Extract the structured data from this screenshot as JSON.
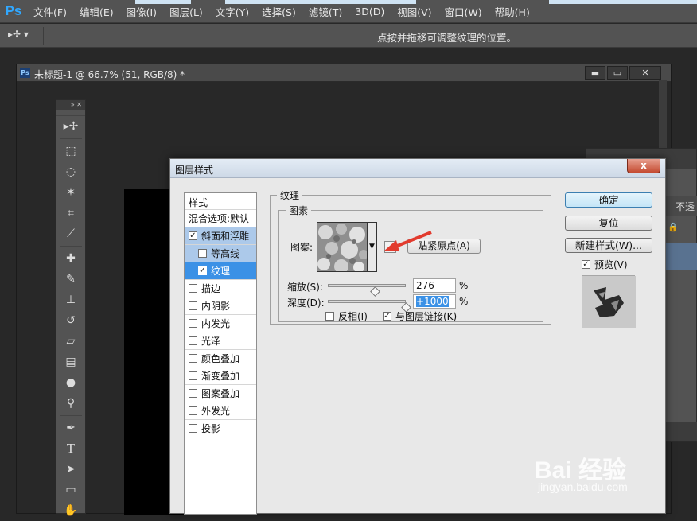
{
  "menubar": {
    "logo": "Ps",
    "items": [
      "文件(F)",
      "编辑(E)",
      "图像(I)",
      "图层(L)",
      "文字(Y)",
      "选择(S)",
      "滤镜(T)",
      "3D(D)",
      "视图(V)",
      "窗口(W)",
      "帮助(H)"
    ]
  },
  "optionsbar": {
    "tool_glyph": "▸✢ ▾",
    "hint": "点按并拖移可调整纹理的位置。"
  },
  "document": {
    "title": "未标题-1 @ 66.7% (51, RGB/8) *",
    "icon_text": "Ps",
    "buttons": [
      "▬",
      "▭",
      "✕"
    ]
  },
  "rightpanel": {
    "opacity_text": "不透",
    "lock_icon": "🔒"
  },
  "dialog": {
    "title": "图层样式",
    "close_label": "x",
    "style_list": {
      "header": "样式",
      "blend_options": "混合选项:默认",
      "items": [
        {
          "label": "斜面和浮雕",
          "checked": true,
          "state": "active"
        },
        {
          "label": "等高线",
          "checked": false,
          "state": "sub"
        },
        {
          "label": "纹理",
          "checked": true,
          "state": "selected"
        },
        {
          "label": "描边",
          "checked": false,
          "state": ""
        },
        {
          "label": "内阴影",
          "checked": false,
          "state": ""
        },
        {
          "label": "内发光",
          "checked": false,
          "state": ""
        },
        {
          "label": "光泽",
          "checked": false,
          "state": ""
        },
        {
          "label": "颜色叠加",
          "checked": false,
          "state": ""
        },
        {
          "label": "渐变叠加",
          "checked": false,
          "state": ""
        },
        {
          "label": "图案叠加",
          "checked": false,
          "state": ""
        },
        {
          "label": "外发光",
          "checked": false,
          "state": ""
        },
        {
          "label": "投影",
          "checked": false,
          "state": ""
        }
      ]
    },
    "texture": {
      "group_title": "纹理",
      "elements_title": "图素",
      "pattern_label": "图案:",
      "snap_button": "贴紧原点(A)",
      "scale_label": "缩放(S):",
      "scale_value": "276",
      "scale_fraction": 0.6,
      "depth_label": "深度(D):",
      "depth_value": "+1000",
      "depth_fraction": 1.0,
      "percent": "%",
      "invert_label": "反相(I)",
      "invert_checked": false,
      "link_label": "与图层链接(K)",
      "link_checked": true
    },
    "buttons": {
      "ok": "确定",
      "reset": "复位",
      "new_style": "新建样式(W)...",
      "preview_label": "预览(V)",
      "preview_checked": true
    }
  },
  "watermark": {
    "main": "Bai 经验",
    "sub": "jingyan.baidu.com"
  },
  "colors": {
    "selected_item": "#3b91e6",
    "active_item": "#acc9ea",
    "arrow": "#e23b2e"
  }
}
